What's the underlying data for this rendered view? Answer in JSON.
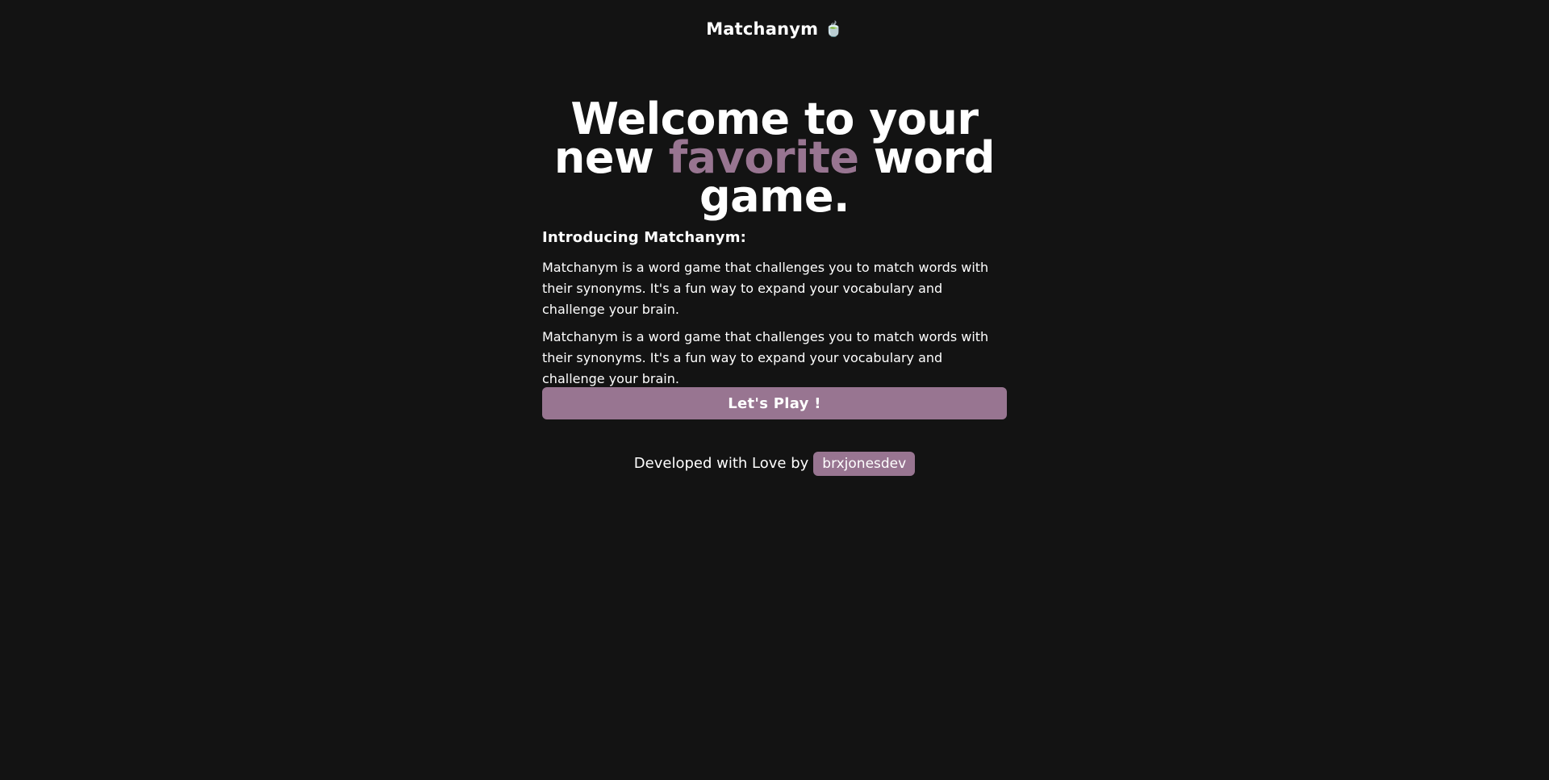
{
  "app": {
    "title": "Matchanym",
    "logo_icon": "tea-icon",
    "logo_glyph": "🍵"
  },
  "hero": {
    "line1": "Welcome to your",
    "line2_before": "new ",
    "line2_accent": "favorite",
    "line2_after": " word",
    "line3": "game."
  },
  "intro": {
    "title": "Introducing Matchanym:",
    "paragraphs": [
      "Matchanym is a word game that challenges you to match words with their synonyms. It's a fun way to expand your vocabulary and challenge your brain.",
      "Matchanym is a word game that challenges you to match words with their synonyms. It's a fun way to expand your vocabulary and challenge your brain."
    ]
  },
  "actions": {
    "play_label": "Let's Play !"
  },
  "footer": {
    "credit_text": "Developed with Love by",
    "author": "brxjonesdev"
  },
  "colors": {
    "background": "#131313",
    "accent": "#987591",
    "text": "#ffffff"
  }
}
